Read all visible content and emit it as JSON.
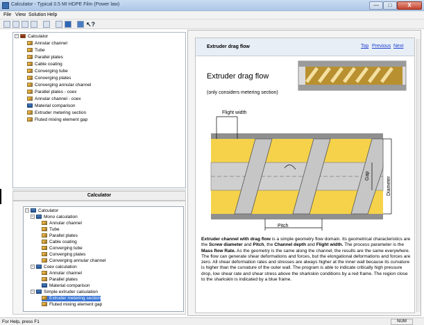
{
  "window": {
    "title": "Calculator - Typical 0.5 MI HDPE Film (Power law)",
    "minimize": "—",
    "maximize": "□",
    "close": "X",
    "accent": "#aec8e8"
  },
  "menu": [
    "File",
    "View",
    "Solution",
    "Help"
  ],
  "toolbar_icons": [
    "new-icon",
    "open-icon",
    "save-icon",
    "save-all-icon",
    "tools-icon",
    "table-icon",
    "chart-icon",
    "grid-icon",
    "help-cursor-icon"
  ],
  "tree_top": {
    "root": "Calculator",
    "items": [
      "Annular channel",
      "Tube",
      "Parallel plates",
      "Cable coating",
      "Converging tube",
      "Converging plates",
      "Converging annular channel",
      "Parallel plates - coex",
      "Annular channel - coex",
      "Material comparison",
      "Extruder metering section",
      "Fluted mixing element gap"
    ]
  },
  "calc_header": "Calculator",
  "tree_bottom": {
    "root": "Calculator",
    "mono": "Mono calculation",
    "mono_items": [
      "Annular channel",
      "Tube",
      "Parallel plates",
      "Cable coating",
      "Converging tube",
      "Converging plates",
      "Converging annular channel"
    ],
    "coex": "Coex calculation",
    "coex_items": [
      "Annular channel",
      "Parallel plates",
      "Material comparison"
    ],
    "extruder": "Simple extruder calculation",
    "extruder_items": [
      "Extruder metering section",
      "Fluted mixing element gap"
    ]
  },
  "doc": {
    "title": "Extruder drag flow",
    "links": {
      "top": "Top",
      "previous": "Previous",
      "next": "Next"
    },
    "fig_title": "Extruder drag flow",
    "fig_subtitle": "(only considers metering section)",
    "labels": {
      "flight_width": "Flight width",
      "gap": "Gap",
      "diameter": "Diameter",
      "pitch": "Pitch"
    },
    "desc": [
      {
        "t": "Extruder channel with drag flow",
        "b": true
      },
      {
        "t": " is a simple geometry flow domain. Its geometrical characteristics are the ",
        "b": false
      },
      {
        "t": "Screw diameter",
        "b": true
      },
      {
        "t": " and ",
        "b": false
      },
      {
        "t": "Pitch",
        "b": true
      },
      {
        "t": ", the ",
        "b": false
      },
      {
        "t": "Channel depth",
        "b": true
      },
      {
        "t": " and ",
        "b": false
      },
      {
        "t": "Flight width.",
        "b": true
      },
      {
        "t": " The process parameter is the ",
        "b": false
      },
      {
        "t": "Mass flow Rate.",
        "b": true
      },
      {
        "t": " As the geometry is the same along the channel, the results are the same everywhere. The flow can generate shear deformations and forces, but the elongational deformations and forces are zero. All shear deformation rates and stresses are always higher at the inner wall because its curvature is higher than the curvature of the outer wall. The program is able to indicate critically high pressure drop, low shear rate and shear stress above the sharkskin conditions by a red frame. The region close to the sharkskin is indicated by a blue frame.",
        "b": false
      }
    ]
  },
  "status": {
    "text": "For Help, press F1",
    "num": "NUM"
  },
  "colors": {
    "channel": "#f5d24a",
    "selection": "#3875d7",
    "link": "#1d3fd0"
  }
}
